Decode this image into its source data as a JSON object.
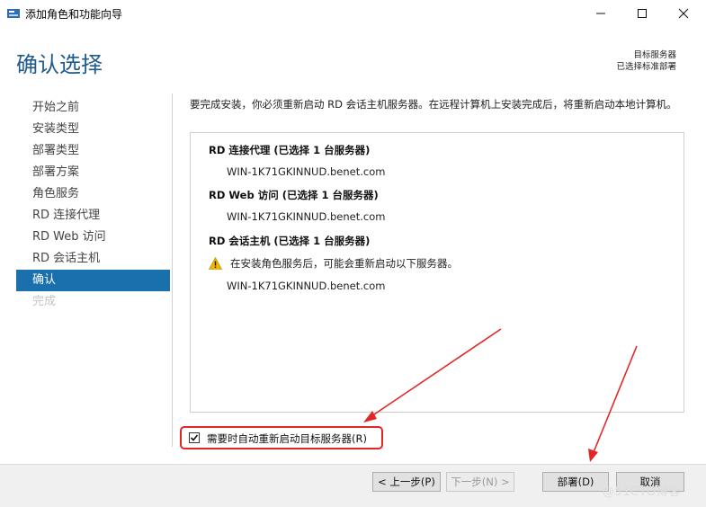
{
  "window": {
    "title": "添加角色和功能向导",
    "controls": {
      "minimize": "minimize-icon",
      "maximize": "maximize-icon",
      "close": "close-icon"
    }
  },
  "page": {
    "title": "确认选择"
  },
  "target_server": {
    "label": "目标服务器",
    "value": "已选择标准部署"
  },
  "sidebar": {
    "items": [
      {
        "label": "开始之前"
      },
      {
        "label": "安装类型"
      },
      {
        "label": "部署类型"
      },
      {
        "label": "部署方案"
      },
      {
        "label": "角色服务"
      },
      {
        "label": "RD 连接代理"
      },
      {
        "label": "RD Web 访问"
      },
      {
        "label": "RD 会话主机"
      },
      {
        "label": "确认",
        "state": "active"
      },
      {
        "label": "完成",
        "state": "disabled"
      }
    ]
  },
  "main": {
    "intro": "要完成安装，你必须重新启动 RD 会话主机服务器。在远程计算机上安装完成后，将重新启动本地计算机。",
    "roles": [
      {
        "title": "RD 连接代理 (已选择 1 台服务器)",
        "server": "WIN-1K71GKINNUD.benet.com"
      },
      {
        "title": "RD Web 访问 (已选择 1 台服务器)",
        "server": "WIN-1K71GKINNUD.benet.com"
      },
      {
        "title": "RD 会话主机 (已选择 1 台服务器)",
        "warning": "在安装角色服务后，可能会重新启动以下服务器。",
        "server": "WIN-1K71GKINNUD.benet.com"
      }
    ],
    "restart_checkbox": {
      "label": "需要时自动重新启动目标服务器(R)",
      "checked": true
    }
  },
  "footer": {
    "prev": "< 上一步(P)",
    "next": "下一步(N) >",
    "install": "部署(D)",
    "cancel": "取消"
  },
  "watermark": "@51CTO博客",
  "colors": {
    "accent": "#1a6fad",
    "title": "#1e5a8a",
    "annotation": "#e32525",
    "warning": "#f2b600"
  }
}
